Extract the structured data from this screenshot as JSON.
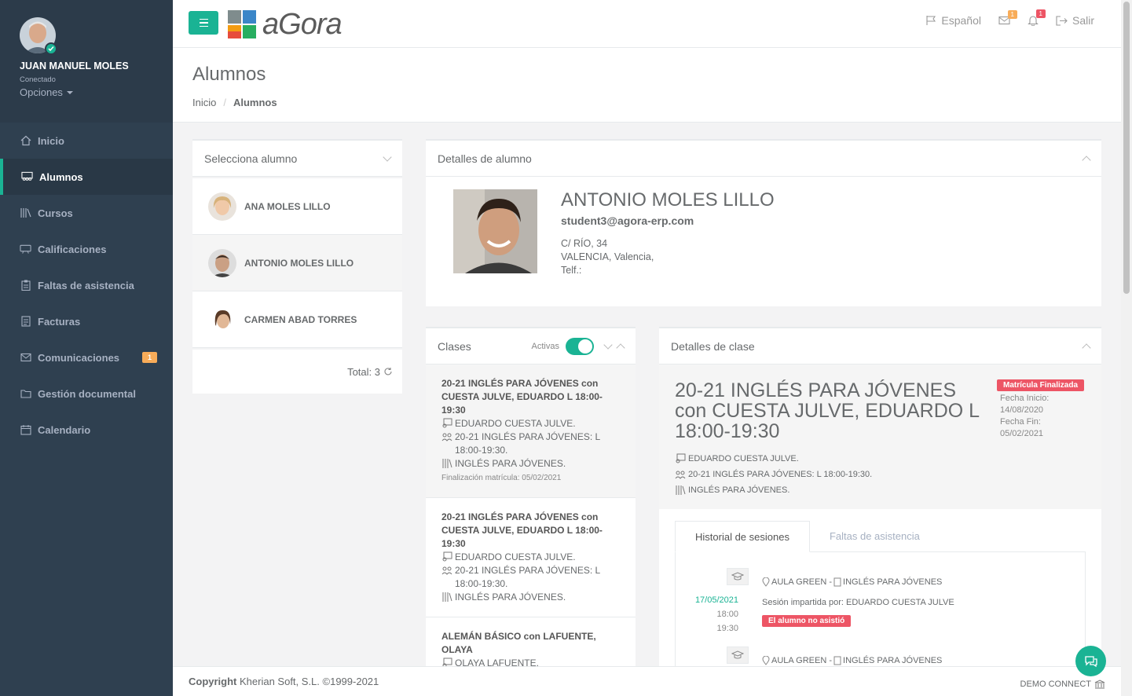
{
  "user": {
    "name": "JUAN MANUEL MOLES",
    "status": "Conectado",
    "options": "Opciones"
  },
  "nav": [
    {
      "label": "Inicio",
      "icon": "home-icon"
    },
    {
      "label": "Alumnos",
      "icon": "students-icon"
    },
    {
      "label": "Cursos",
      "icon": "books-icon"
    },
    {
      "label": "Calificaciones",
      "icon": "grades-icon"
    },
    {
      "label": "Faltas de asistencia",
      "icon": "clipboard-icon"
    },
    {
      "label": "Facturas",
      "icon": "invoice-icon"
    },
    {
      "label": "Comunicaciones",
      "icon": "envelope-icon",
      "badge": "1"
    },
    {
      "label": "Gestión documental",
      "icon": "folder-icon"
    },
    {
      "label": "Calendario",
      "icon": "calendar-icon"
    }
  ],
  "header": {
    "logo": "aGora",
    "language": "Español",
    "mail_badge": "1",
    "bell_badge": "1",
    "logout": "Salir"
  },
  "page": {
    "title": "Alumnos",
    "breadcrumb": [
      "Inicio",
      "Alumnos"
    ]
  },
  "student_select": {
    "title": "Selecciona alumno",
    "students": [
      "ANA MOLES LILLO",
      "ANTONIO MOLES LILLO",
      "CARMEN ABAD TORRES"
    ],
    "total": "Total: 3"
  },
  "student_details": {
    "title": "Detalles de alumno",
    "name": "ANTONIO MOLES LILLO",
    "email": "student3@agora-erp.com",
    "address1": "C/ RÍO, 34",
    "address2": "VALENCIA, Valencia,",
    "phone": "Telf.:"
  },
  "classes": {
    "title": "Clases",
    "toggle_label": "Activas",
    "toggle_on": true,
    "items": [
      {
        "title": "20-21 INGLÉS PARA JÓVENES con CUESTA JULVE, EDUARDO L 18:00-19:30",
        "teacher": "EDUARDO CUESTA JULVE.",
        "group": "20-21 INGLÉS PARA JÓVENES: L 18:00-19:30.",
        "course": "INGLÉS PARA JÓVENES.",
        "end": "Finalización matrícula: 05/02/2021"
      },
      {
        "title": "20-21 INGLÉS PARA JÓVENES con CUESTA JULVE, EDUARDO L 18:00-19:30",
        "teacher": "EDUARDO CUESTA JULVE.",
        "group": "20-21 INGLÉS PARA JÓVENES: L 18:00-19:30.",
        "course": "INGLÉS PARA JÓVENES."
      },
      {
        "title": "ALEMÁN BÁSICO con LAFUENTE, OLAYA",
        "teacher": "OLAYA LAFUENTE."
      }
    ]
  },
  "class_details": {
    "title": "Detalles de clase",
    "name": "20-21 INGLÉS PARA JÓVENES con CUESTA JULVE, EDUARDO L 18:00-19:30",
    "status_label": "Matrícula Finalizada",
    "start_label": "Fecha Inicio:",
    "start": "14/08/2020",
    "end_label": "Fecha Fin:",
    "end": "05/02/2021",
    "teacher": "EDUARDO CUESTA JULVE.",
    "group": "20-21 INGLÉS PARA JÓVENES: L 18:00-19:30.",
    "course": "INGLÉS PARA JÓVENES.",
    "tabs": [
      "Historial de sesiones",
      "Faltas de asistencia"
    ],
    "sessions": [
      {
        "date": "17/05/2021",
        "start": "18:00",
        "end": "19:30",
        "location": "AULA GREEN - ",
        "course": "INGLÉS PARA JÓVENES",
        "taught_by": "Sesión impartida por: EDUARDO CUESTA JULVE",
        "absent": "El alumno no asistió"
      },
      {
        "location": "AULA GREEN - ",
        "course": "INGLÉS PARA JÓVENES"
      }
    ]
  },
  "footer": {
    "copyright_bold": "Copyright",
    "copyright": " Kherian Soft, S.L. ©1999-2021",
    "right": "DEMO CONNECT"
  },
  "colors": {
    "sidebar": "#2f4050",
    "accent": "#1ab394",
    "warning": "#f8ac59",
    "danger": "#ed5565"
  }
}
